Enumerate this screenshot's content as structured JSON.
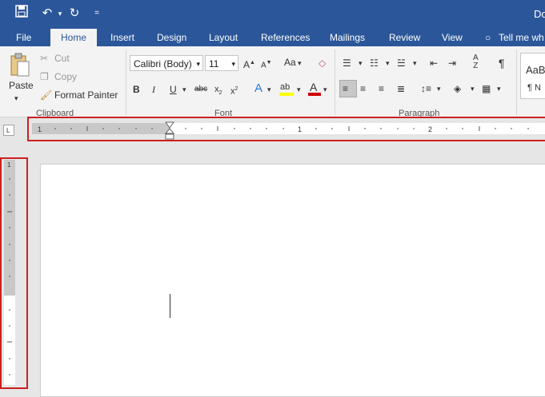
{
  "window": {
    "title": "Do"
  },
  "qat": {
    "save_icon": "save-icon",
    "undo_icon": "undo-icon",
    "redo_icon": "redo-icon",
    "customize_icon": "customize-qat-icon"
  },
  "tabs": [
    {
      "label": "File"
    },
    {
      "label": "Home"
    },
    {
      "label": "Insert"
    },
    {
      "label": "Design"
    },
    {
      "label": "Layout"
    },
    {
      "label": "References"
    },
    {
      "label": "Mailings"
    },
    {
      "label": "Review"
    },
    {
      "label": "View"
    }
  ],
  "tell_me": "Tell me wh",
  "clipboard": {
    "paste": "Paste",
    "cut": "Cut",
    "copy": "Copy",
    "format_painter": "Format Painter",
    "group": "Clipboard"
  },
  "font": {
    "name": "Calibri (Body)",
    "size": "11",
    "change_case": "Aa",
    "group": "Font"
  },
  "paragraph": {
    "group": "Paragraph"
  },
  "styles": {
    "sample": "AaB",
    "name": "¶ N"
  },
  "ruler": {
    "h_labels": [
      "1",
      "1",
      "2"
    ],
    "v_label": "1"
  },
  "colors": {
    "accent": "#2b579a",
    "highlight_border": "#cc1f1f",
    "font_color_bar": "#d00000",
    "highlight_bar": "#ffff00"
  }
}
